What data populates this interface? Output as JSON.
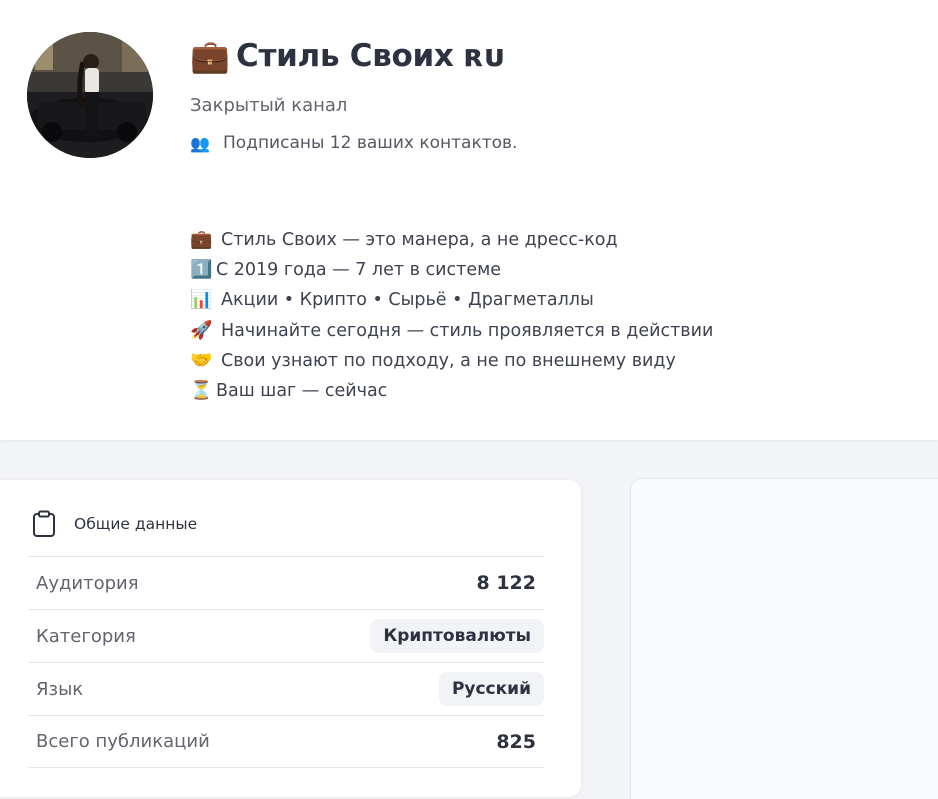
{
  "channel": {
    "title_emoji": "💼",
    "title": "Стиль Своих ʀᴜ",
    "type": "Закрытый канал",
    "contacts_icon": "👥",
    "contacts_text": "Подписаны 12 ваших контактов."
  },
  "description": [
    {
      "icon": "💼",
      "text": "Стиль Своих — это манера, а не дресс-код"
    },
    {
      "icon": "1️⃣",
      "text": "С 2019 года — 7 лет в системе"
    },
    {
      "icon": "📊",
      "text": "Акции • Крипто • Сырьё • Драгметаллы"
    },
    {
      "icon": "🚀",
      "text": "Начинайте сегодня — стиль проявляется в действии"
    },
    {
      "icon": "🤝",
      "text": "Свои узнают по подходу, а не по внешнему виду"
    },
    {
      "icon": "⏳",
      "text": "Ваш шаг — сейчас"
    }
  ],
  "stats": {
    "header_icon": "clipboard-icon",
    "header": "Общие данные",
    "rows": [
      {
        "label": "Аудитория",
        "value": "8 122"
      },
      {
        "label": "Категория",
        "value": "Криптовалюты"
      },
      {
        "label": "Язык",
        "value": "Русский"
      },
      {
        "label": "Всего публикаций",
        "value": "825"
      }
    ]
  }
}
